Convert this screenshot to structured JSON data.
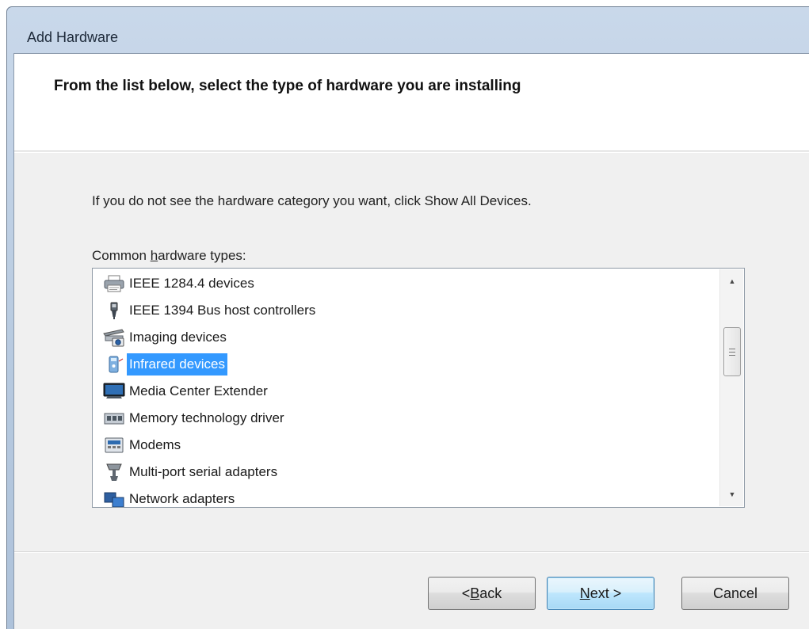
{
  "window": {
    "title": "Add Hardware"
  },
  "header": {
    "title": "From the list below, select the type of hardware you are installing"
  },
  "hint": "If you do not see the hardware category you want, click Show All Devices.",
  "list": {
    "label_prefix": "Common ",
    "label_mnemonic": "h",
    "label_suffix": "ardware types:",
    "items": [
      {
        "label": "IEEE 1284.4 devices",
        "icon": "printer-icon"
      },
      {
        "label": "IEEE 1394 Bus host controllers",
        "icon": "firewire-connector-icon"
      },
      {
        "label": "Imaging devices",
        "icon": "scanner-camera-icon"
      },
      {
        "label": "Infrared devices",
        "icon": "infrared-device-icon",
        "selected": true
      },
      {
        "label": "Media Center Extender",
        "icon": "monitor-icon"
      },
      {
        "label": "Memory technology driver",
        "icon": "memory-card-icon"
      },
      {
        "label": "Modems",
        "icon": "modem-icon"
      },
      {
        "label": "Multi-port serial adapters",
        "icon": "serial-adapter-icon"
      },
      {
        "label": "Network adapters",
        "icon": "network-adapter-icon"
      }
    ],
    "selected_color": "#3399ff"
  },
  "buttons": {
    "back_prefix": "< ",
    "back_mnemonic": "B",
    "back_suffix": "ack",
    "next_mnemonic": "N",
    "next_suffix": "ext >",
    "cancel": "Cancel"
  }
}
